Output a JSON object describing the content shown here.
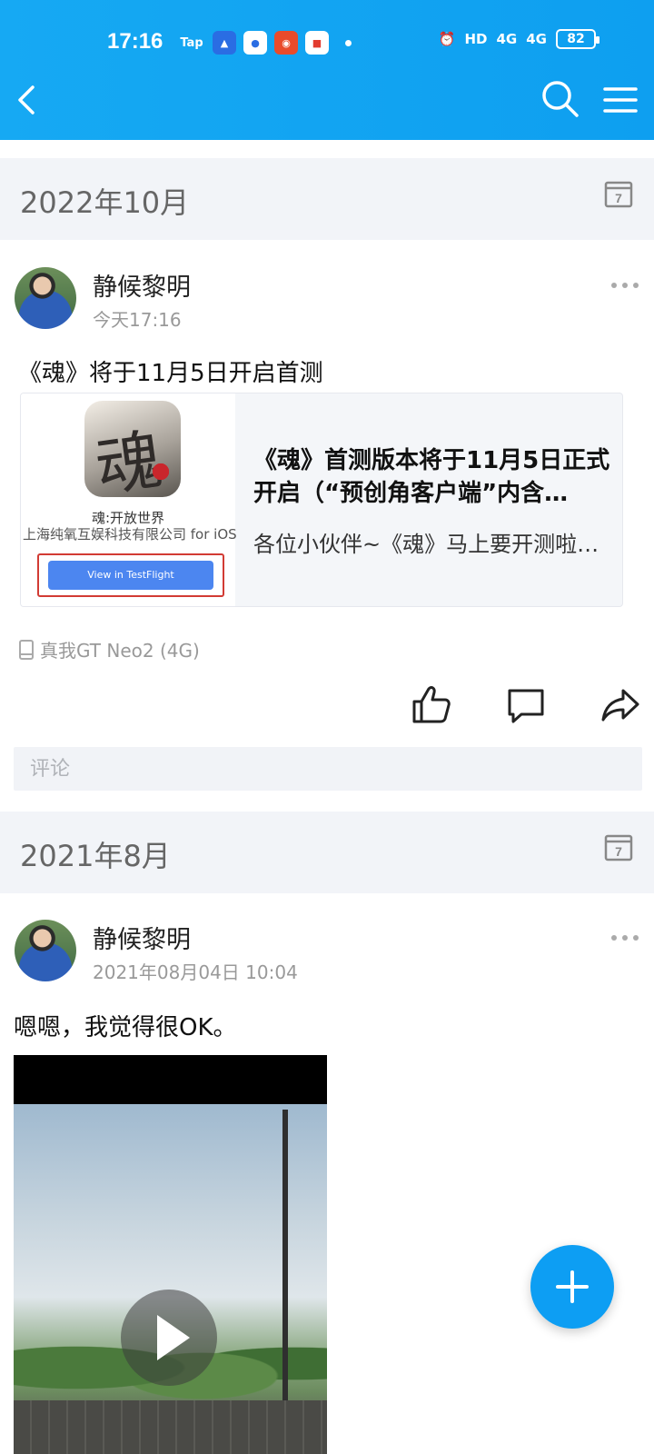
{
  "status_bar": {
    "time": "17:16",
    "tap_label": "Tap",
    "battery": "82",
    "signal1": "4G",
    "signal2": "4G",
    "hd": "HD"
  },
  "nav": {
    "back_icon": "chevron-left-icon",
    "search_icon": "search-icon",
    "menu_icon": "hamburger-menu-icon"
  },
  "sections": [
    {
      "date": "2022年10月",
      "post": {
        "author": "静候黎明",
        "time": "今天17:16",
        "text": "《魂》将于11月5日开启首测",
        "link": {
          "thumb_title": "魂:开放世界",
          "thumb_sub": "上海纯氧互娱科技有限公司 for iOS",
          "thumb_button": "View in TestFlight",
          "title": "《魂》首测版本将于11月5日正式开启（“预创角客户端”内含…",
          "desc": "各位小伙伴~《魂》马上要开测啦…"
        },
        "device": "真我GT Neo2 (4G)",
        "comment_placeholder": "评论"
      }
    },
    {
      "date": "2021年8月",
      "post": {
        "author": "静候黎明",
        "time": "2021年08月04日 10:04",
        "text": "嗯嗯，我觉得很OK。"
      }
    }
  ],
  "colors": {
    "accent": "#0e9ff0",
    "date_bar": "#f2f4f8",
    "fab": "#0d9ef3"
  }
}
